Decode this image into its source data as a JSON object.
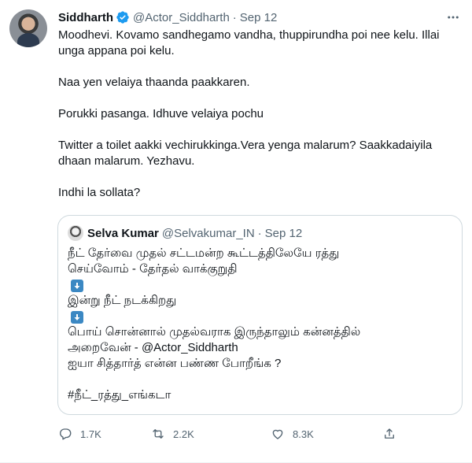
{
  "tweet": {
    "author_name": "Siddharth",
    "author_handle": "@Actor_Siddharth",
    "separator": "·",
    "date": "Sep 12",
    "paragraphs": [
      "Moodhevi. Kovamo sandhegamo vandha, thuppirundha poi nee kelu. Illai unga appana poi kelu.",
      "Naa yen velaiya thaanda paakkaren.",
      "Porukki pasanga. Idhuve velaiya pochu",
      "Twitter a toilet aakki vechirukkinga.Vera yenga malarum? Saakkadaiyila dhaan malarum. Yezhavu.",
      "Indhi la sollata?"
    ]
  },
  "quoted": {
    "author_name": "Selva Kumar",
    "author_handle": "@Selvakumar_IN",
    "separator": "·",
    "date": "Sep 12",
    "lines": [
      "நீட் தேர்வை முதல் சட்டமன்ற கூட்டத்திலேயே ரத்து",
      "செய்வோம் - தேர்தல் வாக்குறுதி",
      "இன்று நீட் நடக்கிறது",
      "பொய் சொன்னால் முதல்வராக இருந்தாலும் கன்னத்தில்",
      "அறைவேன் - @Actor_Siddharth",
      "ஐயா சித்தார்த் என்ன பண்ண போறீங்க ?",
      "#நீட்_ரத்து_எங்கடா"
    ]
  },
  "actions": {
    "reply_count": "1.7K",
    "retweet_count": "2.2K",
    "like_count": "8.3K"
  },
  "icons": {
    "verified": "verified-badge-icon",
    "more": "more-options-icon",
    "reply": "reply-icon",
    "retweet": "retweet-icon",
    "like": "like-icon",
    "share": "share-icon",
    "arrow_emoji": "down-arrow-emoji-icon"
  },
  "colors": {
    "verified_blue": "#1d9bf0",
    "secondary_text": "#536471",
    "border": "#cfd9de",
    "emoji_blue": "#3b88c3"
  }
}
